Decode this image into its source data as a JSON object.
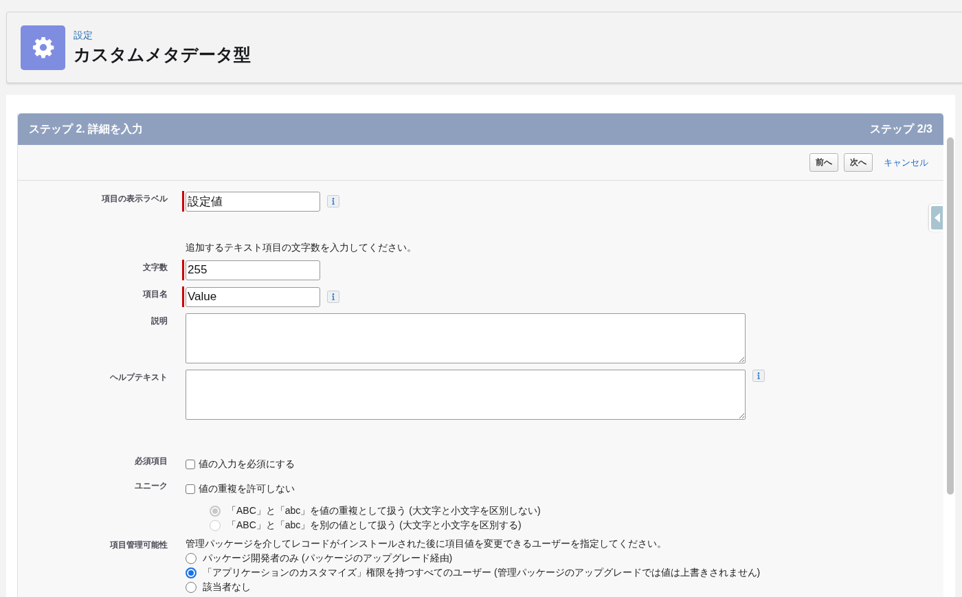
{
  "header": {
    "breadcrumb": "設定",
    "title": "カスタムメタデータ型"
  },
  "step": {
    "title": "ステップ 2. 詳細を入力",
    "counter": "ステップ 2/3"
  },
  "buttons": [
    {
      "label": "前へ",
      "kind": "button"
    },
    {
      "label": "次へ",
      "kind": "button"
    },
    {
      "label": "キャンセル",
      "kind": "link"
    }
  ],
  "form": [
    {
      "kind": "input",
      "label": "項目の表示ラベル",
      "value": "設定値",
      "required": true,
      "info": true
    },
    {
      "kind": "note",
      "text": "追加するテキスト項目の文字数を入力してください。"
    },
    {
      "kind": "input",
      "label": "文字数",
      "value": "255",
      "required": true,
      "info": false
    },
    {
      "kind": "input",
      "label": "項目名",
      "value": "Value",
      "required": true,
      "info": true
    },
    {
      "kind": "textarea",
      "label": "説明",
      "info": false
    },
    {
      "kind": "textarea",
      "label": "ヘルプテキスト",
      "info": true
    },
    {
      "kind": "checkbox",
      "label": "必須項目",
      "text": "値の入力を必須にする",
      "checked": false
    },
    {
      "kind": "checkbox",
      "label": "ユニーク",
      "text": "値の重複を許可しない",
      "checked": false
    },
    {
      "kind": "sub-radios",
      "options": [
        {
          "text": "「ABC」と「abc」を値の重複として扱う (大文字と小文字を区別しない)",
          "selected": true,
          "disabled": true
        },
        {
          "text": "「ABC」と「abc」を別の値として扱う (大文字と小文字を区別する)",
          "selected": false,
          "disabled": true
        }
      ]
    },
    {
      "kind": "radios",
      "label": "項目管理可能性",
      "text": "管理パッケージを介してレコードがインストールされた後に項目値を変更できるユーザーを指定してください。",
      "options": [
        {
          "text": "パッケージ開発者のみ (パッケージのアップグレード経由)",
          "selected": false,
          "disabled": false
        },
        {
          "text": "「アプリケーションのカスタマイズ」権限を持つすべてのユーザー (管理パッケージのアップグレードでは値は上書きされません)",
          "selected": true,
          "disabled": false
        },
        {
          "text": "該当者なし",
          "selected": false,
          "disabled": false
        }
      ]
    }
  ]
}
